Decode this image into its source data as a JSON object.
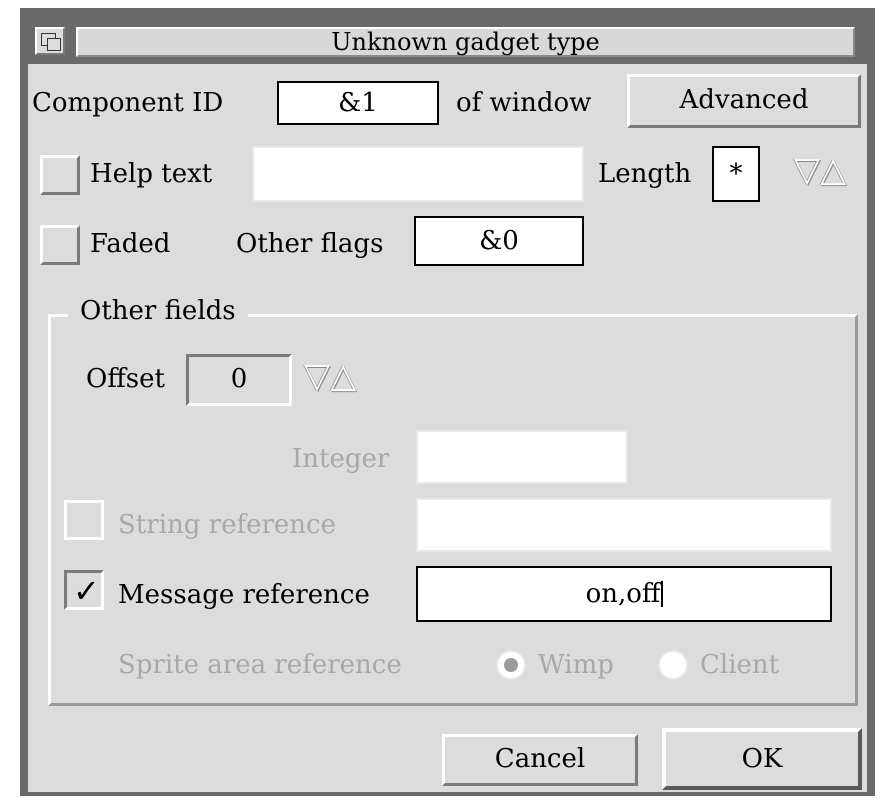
{
  "title": "Unknown gadget type",
  "component_id": {
    "label": "Component ID",
    "value": "&1",
    "suffix": "of window"
  },
  "advanced_button": "Advanced",
  "help_text": {
    "label": "Help text",
    "value": "",
    "checked": false
  },
  "length": {
    "label": "Length",
    "value": "*"
  },
  "faded": {
    "label": "Faded",
    "checked": false
  },
  "other_flags": {
    "label": "Other flags",
    "value": "&0"
  },
  "other_fields": {
    "label": "Other fields",
    "offset": {
      "label": "Offset",
      "value": "0"
    },
    "integer": {
      "label": "Integer",
      "value": ""
    },
    "string_reference": {
      "label": "String reference",
      "value": "",
      "checked": false
    },
    "message_reference": {
      "label": "Message reference",
      "value": "on,off",
      "checked": true
    },
    "sprite_area_reference": {
      "label": "Sprite area reference",
      "options": [
        "Wimp",
        "Client"
      ],
      "selected": "Wimp"
    }
  },
  "buttons": {
    "cancel": "Cancel",
    "ok": "OK"
  },
  "icons": {
    "adjust_arrows": "▽△",
    "tick": "✓"
  }
}
